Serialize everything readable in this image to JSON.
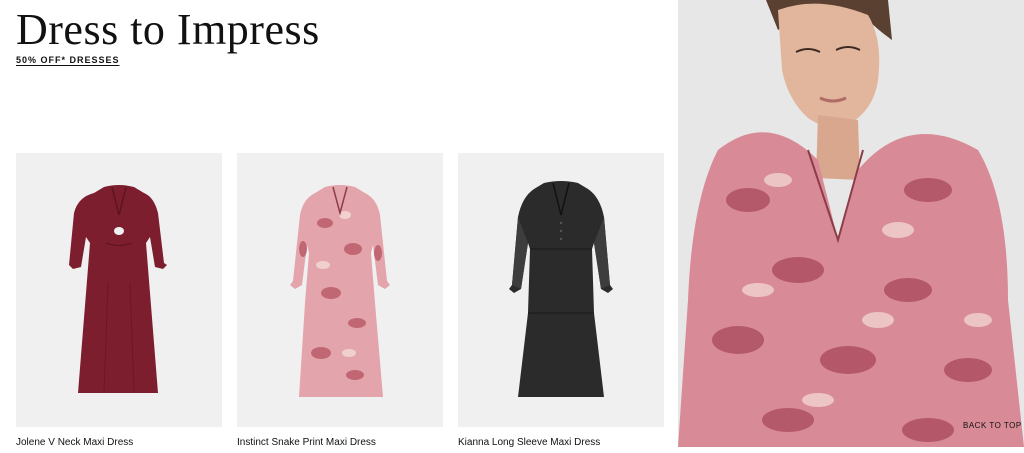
{
  "page": {
    "title": "Dress to Impress",
    "promo_link": "50% OFF* DRESSES"
  },
  "products": [
    {
      "name": "Jolene V Neck Maxi Dress",
      "image_icon": "dress-burgundy-image",
      "color": "#7d1e2e"
    },
    {
      "name": "Instinct Snake Print Maxi Dress",
      "image_icon": "dress-snake-print-image",
      "color": "#d9949c"
    },
    {
      "name": "Kianna Long Sleeve Maxi Dress",
      "image_icon": "dress-black-image",
      "color": "#2b2b2b"
    }
  ],
  "hero": {
    "image_icon": "model-photo",
    "back_to_top": "BACK TO TOP"
  }
}
